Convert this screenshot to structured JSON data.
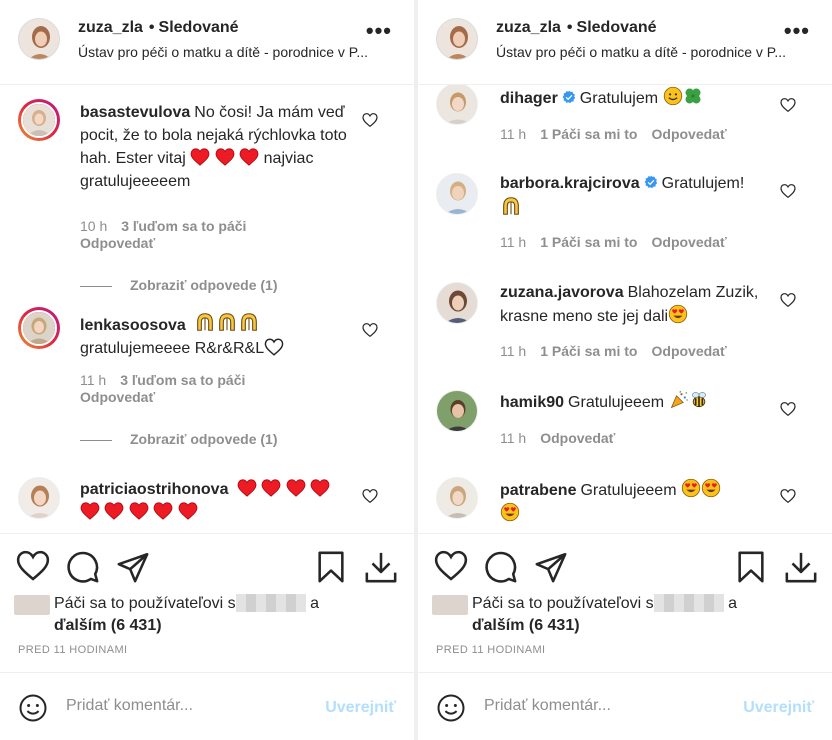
{
  "colors": {
    "text": "#262626",
    "muted": "#8e8e8e",
    "link_disabled": "#b2dffc",
    "heart_red": "#ed1c24",
    "verified_blue": "#3897f0"
  },
  "icons": [
    "heart-icon",
    "comment-icon",
    "share-icon",
    "bookmark-icon",
    "download-icon",
    "smiley-icon",
    "verified-icon",
    "more-icon"
  ],
  "left": {
    "header": {
      "username": "zuza_zla",
      "dot": "•",
      "follow_label": "Sledované",
      "location": "Ústav pro péči o matku a dítě - porodnice v P...",
      "more": "•••"
    },
    "comments": [
      {
        "user": "basastevulova",
        "text_1": "No čosi! Ja mám veď pocit, že to bola nejaká rýchlovka toto hah. Ester vitaj",
        "text_2": "najviac gratulujeeeeem",
        "time": "10 h",
        "likes": "3 ľuďom sa to páči",
        "reply": "Odpovedať",
        "view_replies": "Zobraziť odpovede (1)"
      },
      {
        "user": "lenkasoosova",
        "text": "gratulujemeeee R&r&R&L",
        "time": "11 h",
        "likes": "3 ľuďom sa to páči",
        "reply": "Odpovedať",
        "view_replies": "Zobraziť odpovede (1)"
      },
      {
        "user": "patriciaostrihonova",
        "text": ""
      }
    ],
    "likes": {
      "prefix": "Páči sa to používateľovi s",
      "middle": "a",
      "others": "ďalším (6 431)"
    },
    "timestamp": "PRED 11 HODINAMI",
    "composer": {
      "placeholder": "Pridať komentár...",
      "post": "Uverejniť"
    }
  },
  "right": {
    "header": {
      "username": "zuza_zla",
      "dot": "•",
      "follow_label": "Sledované",
      "location": "Ústav pro péči o matku a dítě - porodnice v P...",
      "more": "•••"
    },
    "comments": [
      {
        "user": "dihager",
        "text": "Gratulujem",
        "time": "11 h",
        "likes": "1 Páči sa mi to",
        "reply": "Odpovedať"
      },
      {
        "user": "barbora.krajcirova",
        "text": "Gratulujem!",
        "time": "11 h",
        "likes": "1 Páči sa mi to",
        "reply": "Odpovedať"
      },
      {
        "user": "zuzana.javorova",
        "text": "Blahozelam Zuzik, krasne meno ste jej dali",
        "time": "11 h",
        "likes": "1 Páči sa mi to",
        "reply": "Odpovedať"
      },
      {
        "user": "hamik90",
        "text": "Gratulujeeem",
        "time": "11 h",
        "reply": "Odpovedať"
      },
      {
        "user": "patrabene",
        "text": "Gratulujeeem"
      }
    ],
    "likes": {
      "prefix": "Páči sa to používateľovi s",
      "middle": "a",
      "others": "ďalším (6 431)"
    },
    "timestamp": "PRED 11 HODINAMI",
    "composer": {
      "placeholder": "Pridať komentár...",
      "post": "Uverejniť"
    }
  }
}
